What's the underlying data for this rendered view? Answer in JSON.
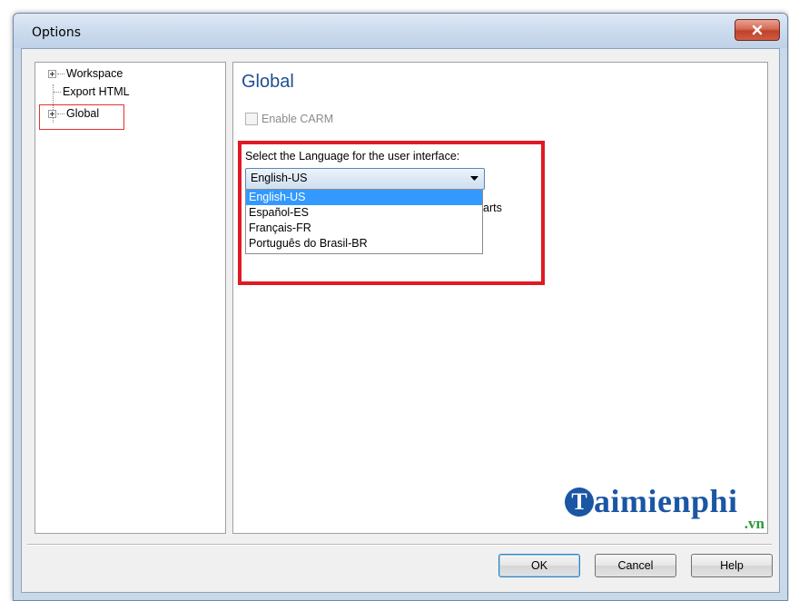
{
  "window": {
    "title": "Options"
  },
  "tree": {
    "items": [
      {
        "label": "Workspace",
        "expandable": true
      },
      {
        "label": "Export HTML",
        "expandable": false
      },
      {
        "label": "Global",
        "expandable": true,
        "highlighted": true
      }
    ]
  },
  "panel": {
    "title": "Global",
    "enable_carm_label": "Enable CARM",
    "language_label": "Select the Language for the user interface:",
    "language_selected": "English-US",
    "language_options": [
      "English-US",
      "Español-ES",
      "Français-FR",
      "Português do Brasil-BR"
    ],
    "partial_hidden_text": "arts"
  },
  "watermark": {
    "badge": "T",
    "text": "aimienphi",
    "suffix": ".vn"
  },
  "buttons": {
    "ok": "OK",
    "cancel": "Cancel",
    "help": "Help"
  },
  "colors": {
    "panel_title": "#1f4f8f",
    "highlight_red": "#e01a22",
    "selection": "#3399ff",
    "logo_blue": "#1b56a5",
    "logo_green": "#2a9a3a"
  }
}
